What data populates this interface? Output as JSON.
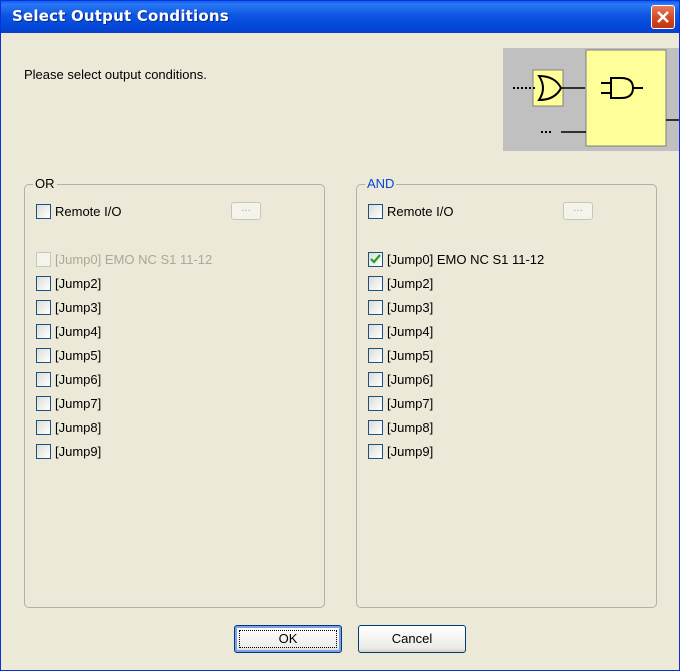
{
  "window": {
    "title": "Select Output Conditions"
  },
  "prompt": "Please select output conditions.",
  "groups": [
    {
      "legend": "OR",
      "remote_label": "Remote I/O",
      "remote_btn": "...",
      "items": [
        {
          "label": "[Jump0] EMO NC S1 11-12",
          "checked": false,
          "disabled": true
        },
        {
          "label": "[Jump2]",
          "checked": false,
          "disabled": false
        },
        {
          "label": "[Jump3]",
          "checked": false,
          "disabled": false
        },
        {
          "label": "[Jump4]",
          "checked": false,
          "disabled": false
        },
        {
          "label": "[Jump5]",
          "checked": false,
          "disabled": false
        },
        {
          "label": "[Jump6]",
          "checked": false,
          "disabled": false
        },
        {
          "label": "[Jump7]",
          "checked": false,
          "disabled": false
        },
        {
          "label": "[Jump8]",
          "checked": false,
          "disabled": false
        },
        {
          "label": "[Jump9]",
          "checked": false,
          "disabled": false
        }
      ]
    },
    {
      "legend": "AND",
      "remote_label": "Remote I/O",
      "remote_btn": "...",
      "items": [
        {
          "label": "[Jump0] EMO NC S1 11-12",
          "checked": true,
          "disabled": false
        },
        {
          "label": "[Jump2]",
          "checked": false,
          "disabled": false
        },
        {
          "label": "[Jump3]",
          "checked": false,
          "disabled": false
        },
        {
          "label": "[Jump4]",
          "checked": false,
          "disabled": false
        },
        {
          "label": "[Jump5]",
          "checked": false,
          "disabled": false
        },
        {
          "label": "[Jump6]",
          "checked": false,
          "disabled": false
        },
        {
          "label": "[Jump7]",
          "checked": false,
          "disabled": false
        },
        {
          "label": "[Jump8]",
          "checked": false,
          "disabled": false
        },
        {
          "label": "[Jump9]",
          "checked": false,
          "disabled": false
        }
      ]
    }
  ],
  "buttons": {
    "ok": "OK",
    "cancel": "Cancel"
  },
  "colors": {
    "title_bar": "#0a5ef2",
    "gate_fill": "#ffff99",
    "check": "#21a121",
    "or_legend": "#000000",
    "and_legend": "#0046d5"
  }
}
